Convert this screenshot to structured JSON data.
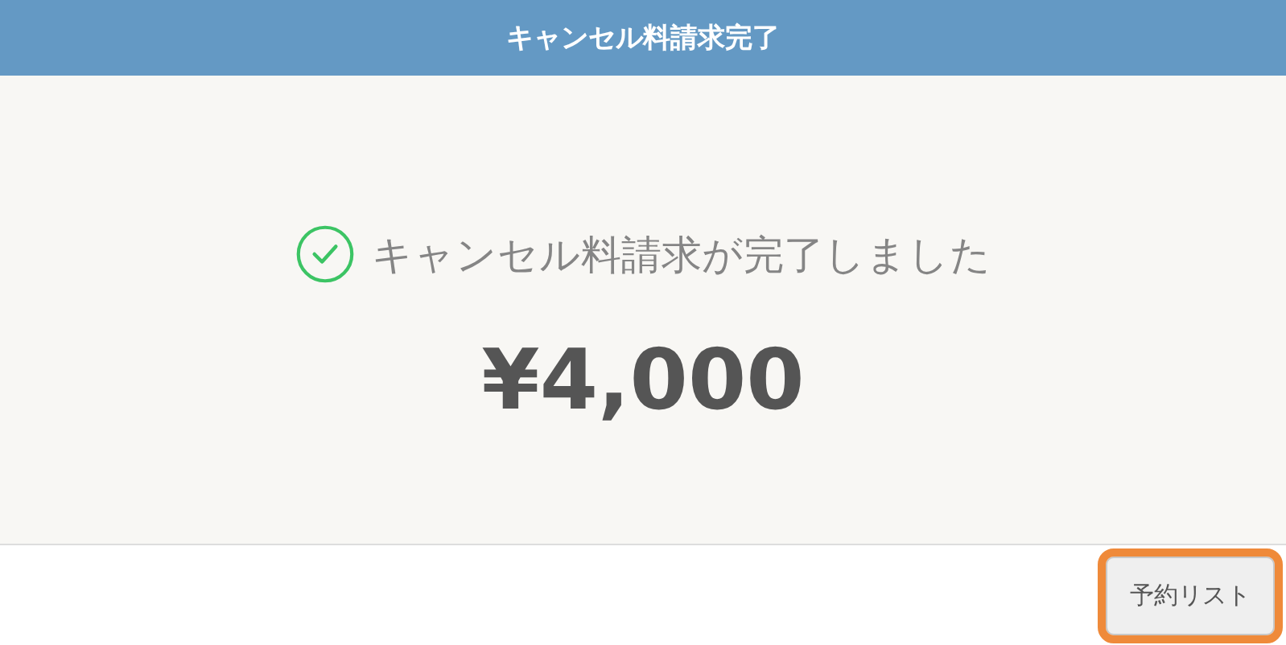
{
  "header": {
    "title": "キャンセル料請求完了"
  },
  "result": {
    "message": "キャンセル料請求が完了しました",
    "amount": "¥4,000"
  },
  "footer": {
    "buttons": [
      {
        "label": "予約リスト",
        "focused": true
      }
    ]
  }
}
